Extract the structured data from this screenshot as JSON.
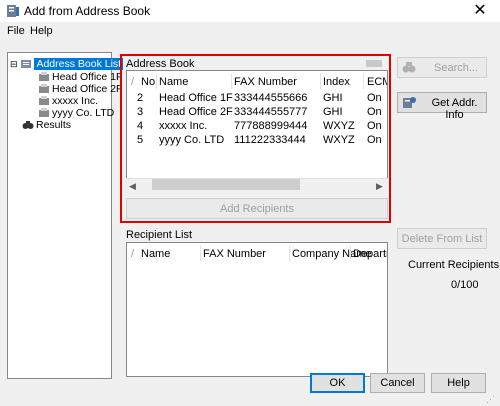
{
  "window": {
    "title": "Add from Address Book",
    "close_glyph": "✕"
  },
  "menu": {
    "file": "File",
    "help": "Help"
  },
  "tree": {
    "root": "Address Book List",
    "children": [
      "Head Office 1F",
      "Head Office 2F",
      "xxxxx Inc.",
      "yyyy Co. LTD"
    ],
    "results": "Results"
  },
  "address_book": {
    "group_label": "Address Book",
    "columns": [
      "No.",
      "Name",
      "FAX Number",
      "Index",
      "ECM"
    ],
    "rows": [
      [
        "2",
        "Head Office 1F",
        "333444555666",
        "GHI",
        "On"
      ],
      [
        "3",
        "Head Office 2F",
        "333444555777",
        "GHI",
        "On"
      ],
      [
        "4",
        "xxxxx Inc.",
        "777888999444",
        "WXYZ",
        "On"
      ],
      [
        "5",
        "yyyy Co. LTD",
        "111222333444",
        "WXYZ",
        "On"
      ]
    ],
    "add_recipients_label": "Add Recipients"
  },
  "side_buttons": {
    "search": "Search...",
    "get_addr_info": "Get Addr. Info",
    "delete_from_list": "Delete From List"
  },
  "recipient_list": {
    "label": "Recipient List",
    "columns": [
      "Name",
      "FAX Number",
      "Company Name",
      "Departmer"
    ]
  },
  "current_recipients": {
    "label": "Current Recipients",
    "count": "0/100"
  },
  "footer": {
    "ok": "OK",
    "cancel": "Cancel",
    "help": "Help"
  },
  "colors": {
    "selection": "#0078d7",
    "highlight_frame": "#e00000"
  }
}
